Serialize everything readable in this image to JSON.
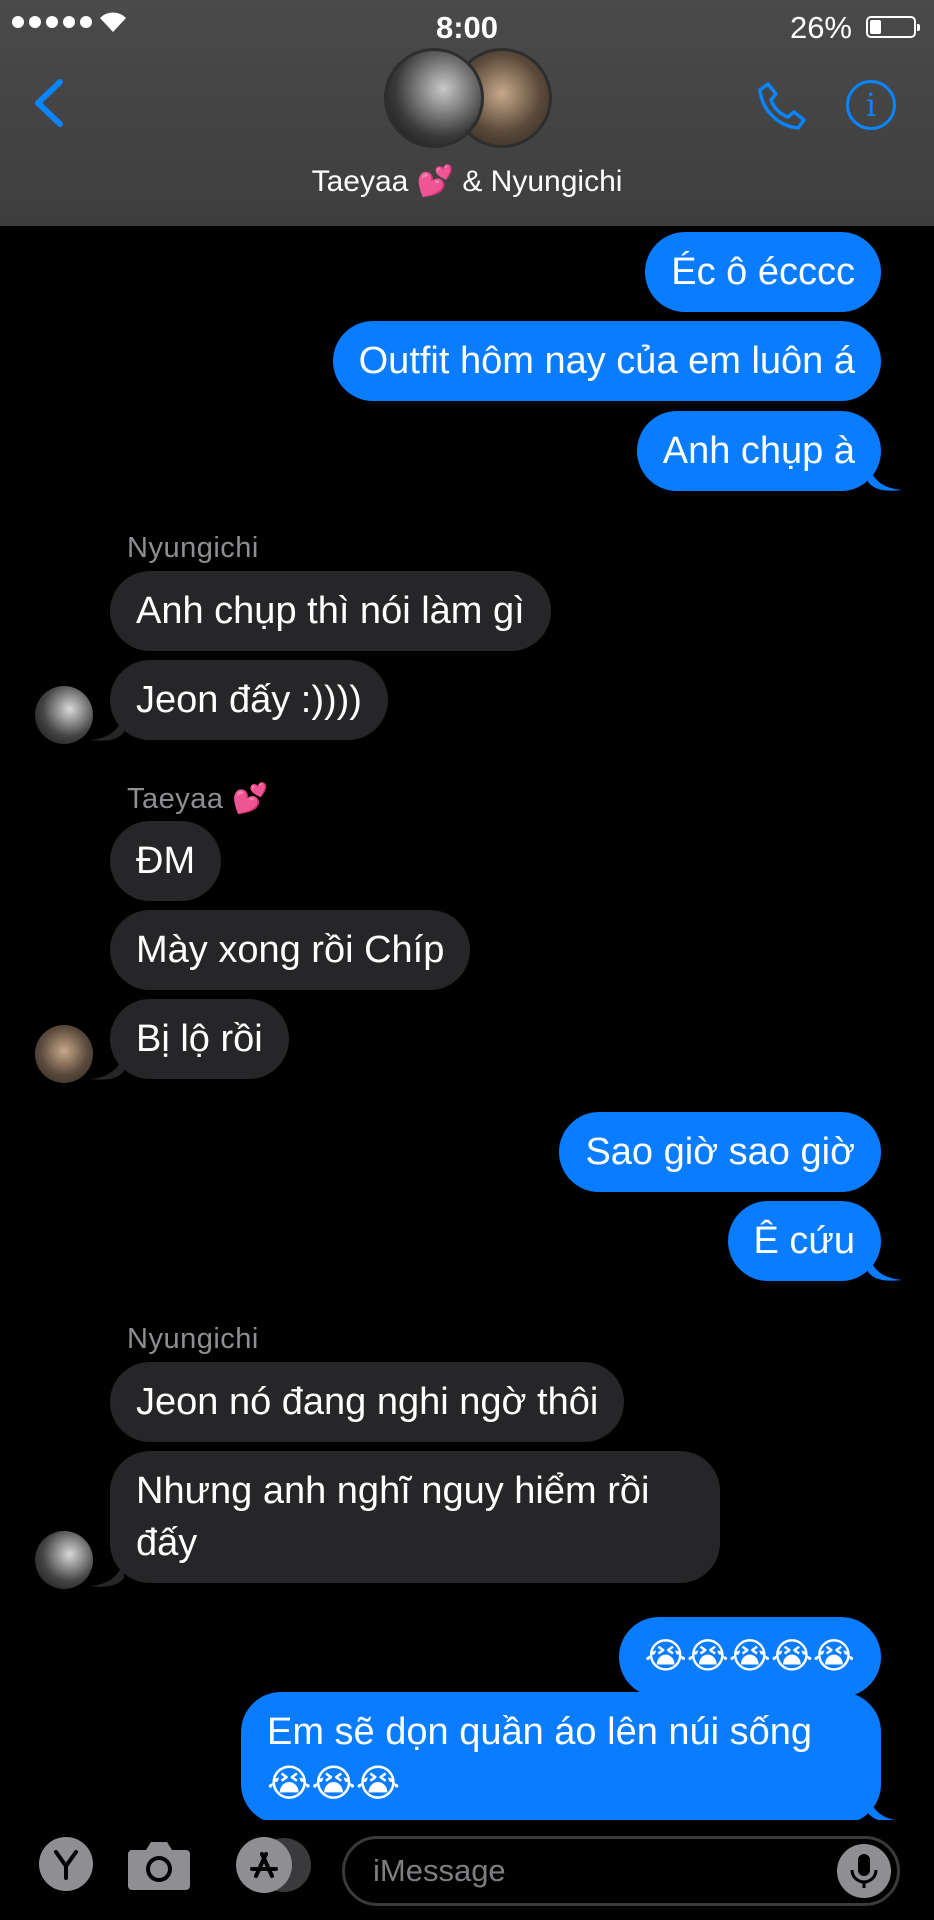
{
  "status_bar": {
    "time": "8:00",
    "battery_percent": "26%",
    "battery_level": 0.26
  },
  "header": {
    "title": "Taeyaa 💕 & Nyungichi"
  },
  "messages": [
    {
      "from": "me",
      "text": "Éc ô écccc"
    },
    {
      "from": "me",
      "text": "Outfit hôm nay của em luôn á"
    },
    {
      "from": "me",
      "text": "Anh chụp à"
    },
    {
      "from": "Nyungichi",
      "sender_label": "Nyungichi",
      "text": "Anh chụp thì nói làm gì"
    },
    {
      "from": "Nyungichi",
      "text": "Jeon đấy :))))"
    },
    {
      "from": "Taeyaa",
      "sender_label": "Taeyaa 💕",
      "text": "ĐM"
    },
    {
      "from": "Taeyaa",
      "text": "Mày xong rồi Chíp"
    },
    {
      "from": "Taeyaa",
      "text": "Bị lộ rồi"
    },
    {
      "from": "me",
      "text": "Sao giờ sao giờ"
    },
    {
      "from": "me",
      "text": "Ê cứu"
    },
    {
      "from": "Nyungichi",
      "sender_label": "Nyungichi",
      "text": "Jeon nó đang nghi ngờ thôi"
    },
    {
      "from": "Nyungichi",
      "text": "Nhưng anh nghĩ nguy hiểm rồi đấy"
    },
    {
      "from": "me",
      "text": "😭😭😭😭😭"
    },
    {
      "from": "me",
      "text": "Em sẽ dọn quần áo lên núi sống 😭😭😭"
    }
  ],
  "input_bar": {
    "placeholder": "iMessage"
  },
  "icons": [
    "back-chevron-icon",
    "phone-icon",
    "info-icon",
    "camera-icon",
    "app-store-icon",
    "mic-icon"
  ],
  "colors": {
    "outgoing_bubble": "#0a7cff",
    "incoming_bubble": "#262628",
    "accent": "#0a84ff"
  }
}
